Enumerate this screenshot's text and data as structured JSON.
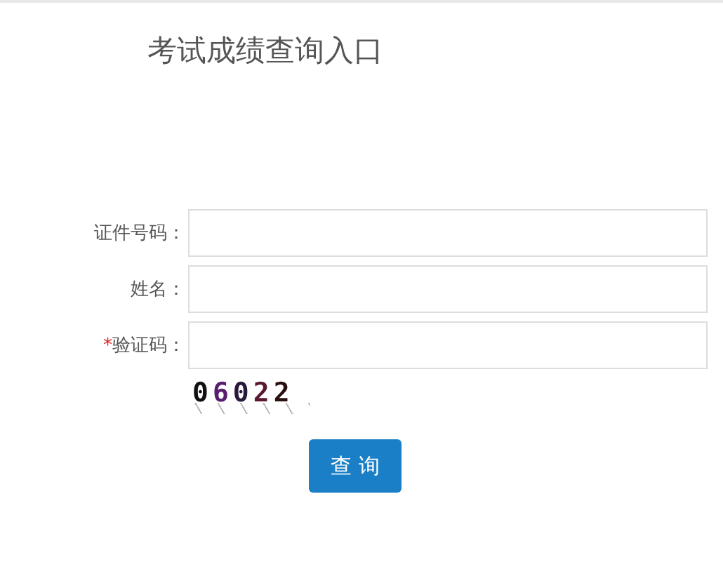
{
  "title": "考试成绩查询入口",
  "fields": [
    {
      "label": "证件号码："
    },
    {
      "label": "姓名："
    },
    {
      "label": "验证码：",
      "required_mark": "*"
    }
  ],
  "captcha": "06022",
  "button": "查 询"
}
